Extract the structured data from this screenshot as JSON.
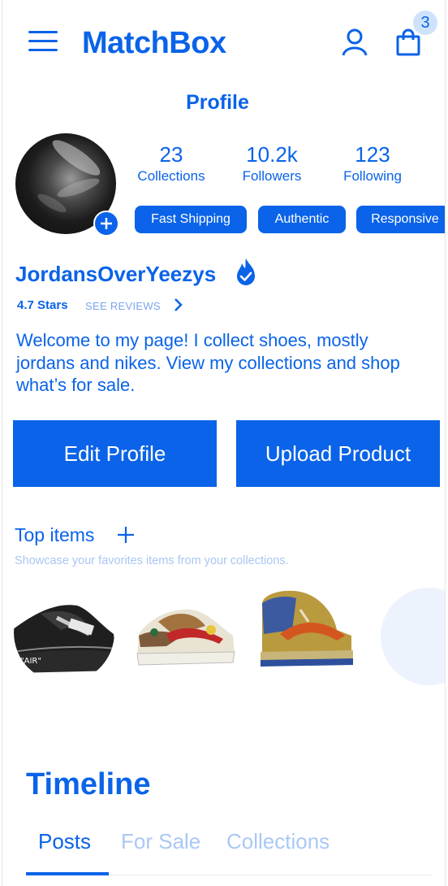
{
  "header": {
    "brand": "MatchBox",
    "cart_count": "3"
  },
  "profile": {
    "section_title": "Profile",
    "stats": [
      {
        "value": "23",
        "label": "Collections"
      },
      {
        "value": "10.2k",
        "label": "Followers"
      },
      {
        "value": "123",
        "label": "Following"
      }
    ],
    "tags": [
      "Fast Shipping",
      "Authentic",
      "Responsive"
    ],
    "username": "JordansOverYeezys",
    "rating": "4.7 Stars",
    "see_reviews": "SEE REVIEWS",
    "bio": "Welcome to my page! I collect shoes, mostly jordans and nikes. View my collections and shop what’s for sale.",
    "edit_button": "Edit Profile",
    "upload_button": "Upload Product"
  },
  "top_items": {
    "title": "Top items",
    "subtitle": "Showcase your favorites items from your collections.",
    "items": [
      {
        "name": "shoe-black-air",
        "sole_text": "\"AIR\""
      },
      {
        "name": "shoe-floral-red"
      },
      {
        "name": "shoe-tan-orange"
      }
    ]
  },
  "timeline": {
    "title": "Timeline",
    "tabs": [
      "Posts",
      "For Sale",
      "Collections"
    ],
    "active_tab": "Posts"
  },
  "colors": {
    "primary": "#0a63e8",
    "light": "#a9c8f4",
    "badge": "#cfe2fb"
  }
}
